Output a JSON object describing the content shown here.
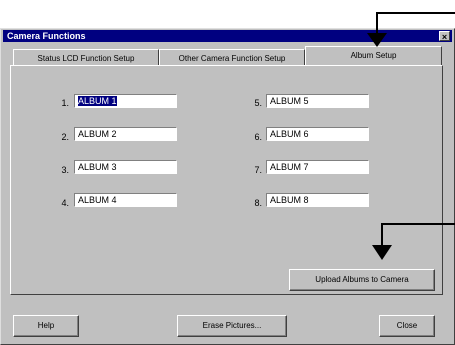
{
  "window": {
    "title": "Camera Functions",
    "close_glyph": "×"
  },
  "tabs": [
    {
      "label": "Status LCD Function Setup",
      "active": false
    },
    {
      "label": "Other Camera Function Setup",
      "active": false
    },
    {
      "label": "Album Setup",
      "active": true
    }
  ],
  "albums": [
    {
      "number": "1.",
      "value": "ALBUM 1"
    },
    {
      "number": "2.",
      "value": "ALBUM 2"
    },
    {
      "number": "3.",
      "value": "ALBUM 3"
    },
    {
      "number": "4.",
      "value": "ALBUM 4"
    },
    {
      "number": "5.",
      "value": "ALBUM 5"
    },
    {
      "number": "6.",
      "value": "ALBUM 6"
    },
    {
      "number": "7.",
      "value": "ALBUM 7"
    },
    {
      "number": "8.",
      "value": "ALBUM 8"
    }
  ],
  "buttons": {
    "upload": "Upload Albums to Camera",
    "help": "Help",
    "erase": "Erase Pictures...",
    "close": "Close"
  },
  "colors": {
    "titlebar": "#000080",
    "face": "#c0c0c0",
    "selection": "#000080",
    "callout_arrow": "#000000"
  }
}
